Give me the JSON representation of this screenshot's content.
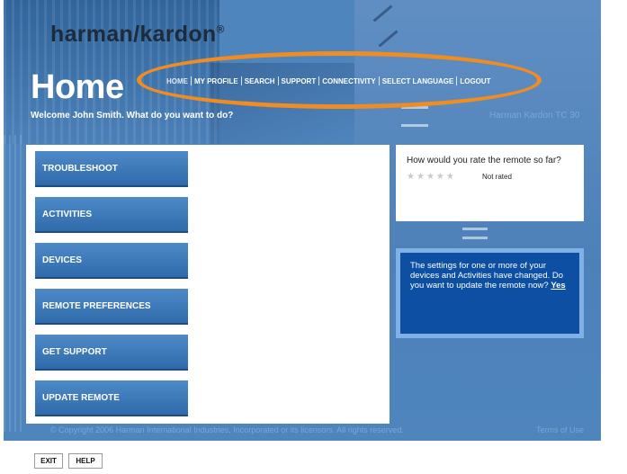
{
  "brand": {
    "name": "harman/kardon",
    "mark": "®"
  },
  "header": {
    "title": "Home",
    "welcome": "Welcome John Smith. What do you want to do?",
    "model": "Harman Kardon TC 30"
  },
  "nav": {
    "items": [
      {
        "label": "HOME",
        "active": true
      },
      {
        "label": "MY PROFILE"
      },
      {
        "label": "SEARCH"
      },
      {
        "label": "SUPPORT"
      },
      {
        "label": "CONNECTIVITY"
      },
      {
        "label": "SELECT LANGUAGE"
      },
      {
        "label": "LOGOUT"
      }
    ],
    "highlight_color": "#ef8c22"
  },
  "menu": {
    "items": [
      {
        "label": "TROUBLESHOOT"
      },
      {
        "label": "ACTIVITIES"
      },
      {
        "label": "DEVICES"
      },
      {
        "label": "REMOTE PREFERENCES"
      },
      {
        "label": "GET SUPPORT"
      },
      {
        "label": "UPDATE REMOTE"
      }
    ]
  },
  "rating": {
    "question": "How would you rate the remote so far?",
    "stars_total": 5,
    "stars_filled": 0,
    "status": "Not rated"
  },
  "update_notice": {
    "text": "The settings for one or more of your devices and Activities have changed. Do you want to update the remote now?",
    "link": "Yes"
  },
  "footer": {
    "copyright": "© Copyright 2006 Harman International Industries, Incorporated or its licensors. All rights reserved.",
    "terms": "Terms of Use"
  },
  "buttons": {
    "exit": "EXIT",
    "help": "HELP"
  },
  "colors": {
    "background": "#4f85bd",
    "menu_button": "#2f6aaa",
    "notice_bg": "#0d4fa3",
    "notice_border": "#7fb0e6"
  }
}
